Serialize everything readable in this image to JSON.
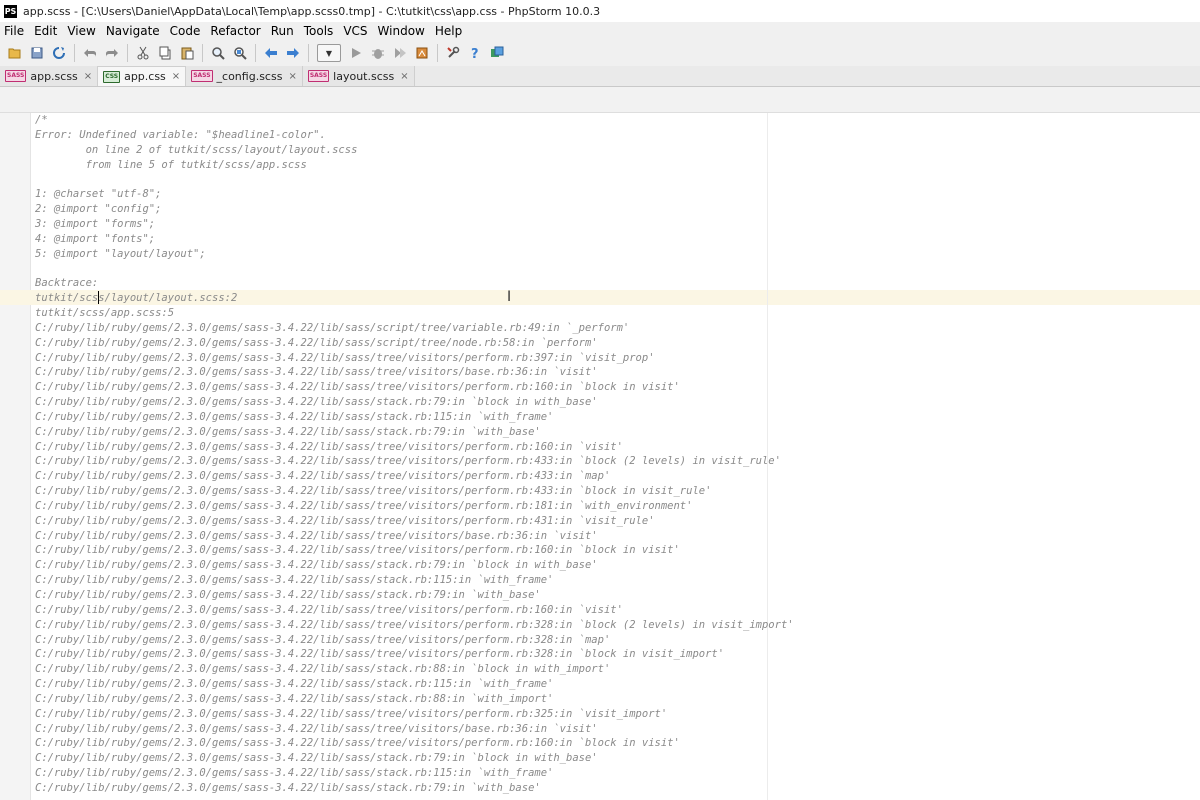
{
  "window": {
    "title": "app.scss - [C:\\Users\\Daniel\\AppData\\Local\\Temp\\app.scss0.tmp] - C:\\tutkit\\css\\app.css - PhpStorm 10.0.3",
    "icon_label": "PS"
  },
  "menu": [
    "File",
    "Edit",
    "View",
    "Navigate",
    "Code",
    "Refactor",
    "Run",
    "Tools",
    "VCS",
    "Window",
    "Help"
  ],
  "toolbar": {
    "icons": [
      "open-folder-icon",
      "save-icon",
      "sync-icon",
      "undo-icon",
      "redo-icon",
      "cut-icon",
      "copy-icon",
      "paste-icon",
      "find-icon",
      "replace-icon",
      "back-icon",
      "forward-icon",
      "run-config-combo",
      "run-icon",
      "debug-icon",
      "coverage-icon",
      "profile-icon",
      "settings-icon",
      "help-icon",
      "phpstorm-update-icon"
    ]
  },
  "tabs": [
    {
      "label": "app.scss",
      "type": "SASS",
      "close": "×"
    },
    {
      "label": "app.css",
      "type": "CSS",
      "close": "×"
    },
    {
      "label": "_config.scss",
      "type": "SASS",
      "close": "×"
    },
    {
      "label": "layout.scss",
      "type": "SASS",
      "close": "×"
    }
  ],
  "editor": {
    "lines": [
      "/*",
      "Error: Undefined variable: \"$headline1-color\".",
      "        on line 2 of tutkit/scss/layout/layout.scss",
      "        from line 5 of tutkit/scss/app.scss",
      "",
      "1: @charset \"utf-8\";",
      "2: @import \"config\";",
      "3: @import \"forms\";",
      "4: @import \"fonts\";",
      "5: @import \"layout/layout\";",
      "",
      "Backtrace:",
      "tutkit/scss/layout/layout.scss:2",
      "tutkit/scss/app.scss:5",
      "C:/ruby/lib/ruby/gems/2.3.0/gems/sass-3.4.22/lib/sass/script/tree/variable.rb:49:in `_perform'",
      "C:/ruby/lib/ruby/gems/2.3.0/gems/sass-3.4.22/lib/sass/script/tree/node.rb:58:in `perform'",
      "C:/ruby/lib/ruby/gems/2.3.0/gems/sass-3.4.22/lib/sass/tree/visitors/perform.rb:397:in `visit_prop'",
      "C:/ruby/lib/ruby/gems/2.3.0/gems/sass-3.4.22/lib/sass/tree/visitors/base.rb:36:in `visit'",
      "C:/ruby/lib/ruby/gems/2.3.0/gems/sass-3.4.22/lib/sass/tree/visitors/perform.rb:160:in `block in visit'",
      "C:/ruby/lib/ruby/gems/2.3.0/gems/sass-3.4.22/lib/sass/stack.rb:79:in `block in with_base'",
      "C:/ruby/lib/ruby/gems/2.3.0/gems/sass-3.4.22/lib/sass/stack.rb:115:in `with_frame'",
      "C:/ruby/lib/ruby/gems/2.3.0/gems/sass-3.4.22/lib/sass/stack.rb:79:in `with_base'",
      "C:/ruby/lib/ruby/gems/2.3.0/gems/sass-3.4.22/lib/sass/tree/visitors/perform.rb:160:in `visit'",
      "C:/ruby/lib/ruby/gems/2.3.0/gems/sass-3.4.22/lib/sass/tree/visitors/perform.rb:433:in `block (2 levels) in visit_rule'",
      "C:/ruby/lib/ruby/gems/2.3.0/gems/sass-3.4.22/lib/sass/tree/visitors/perform.rb:433:in `map'",
      "C:/ruby/lib/ruby/gems/2.3.0/gems/sass-3.4.22/lib/sass/tree/visitors/perform.rb:433:in `block in visit_rule'",
      "C:/ruby/lib/ruby/gems/2.3.0/gems/sass-3.4.22/lib/sass/tree/visitors/perform.rb:181:in `with_environment'",
      "C:/ruby/lib/ruby/gems/2.3.0/gems/sass-3.4.22/lib/sass/tree/visitors/perform.rb:431:in `visit_rule'",
      "C:/ruby/lib/ruby/gems/2.3.0/gems/sass-3.4.22/lib/sass/tree/visitors/base.rb:36:in `visit'",
      "C:/ruby/lib/ruby/gems/2.3.0/gems/sass-3.4.22/lib/sass/tree/visitors/perform.rb:160:in `block in visit'",
      "C:/ruby/lib/ruby/gems/2.3.0/gems/sass-3.4.22/lib/sass/stack.rb:79:in `block in with_base'",
      "C:/ruby/lib/ruby/gems/2.3.0/gems/sass-3.4.22/lib/sass/stack.rb:115:in `with_frame'",
      "C:/ruby/lib/ruby/gems/2.3.0/gems/sass-3.4.22/lib/sass/stack.rb:79:in `with_base'",
      "C:/ruby/lib/ruby/gems/2.3.0/gems/sass-3.4.22/lib/sass/tree/visitors/perform.rb:160:in `visit'",
      "C:/ruby/lib/ruby/gems/2.3.0/gems/sass-3.4.22/lib/sass/tree/visitors/perform.rb:328:in `block (2 levels) in visit_import'",
      "C:/ruby/lib/ruby/gems/2.3.0/gems/sass-3.4.22/lib/sass/tree/visitors/perform.rb:328:in `map'",
      "C:/ruby/lib/ruby/gems/2.3.0/gems/sass-3.4.22/lib/sass/tree/visitors/perform.rb:328:in `block in visit_import'",
      "C:/ruby/lib/ruby/gems/2.3.0/gems/sass-3.4.22/lib/sass/stack.rb:88:in `block in with_import'",
      "C:/ruby/lib/ruby/gems/2.3.0/gems/sass-3.4.22/lib/sass/stack.rb:115:in `with_frame'",
      "C:/ruby/lib/ruby/gems/2.3.0/gems/sass-3.4.22/lib/sass/stack.rb:88:in `with_import'",
      "C:/ruby/lib/ruby/gems/2.3.0/gems/sass-3.4.22/lib/sass/tree/visitors/perform.rb:325:in `visit_import'",
      "C:/ruby/lib/ruby/gems/2.3.0/gems/sass-3.4.22/lib/sass/tree/visitors/base.rb:36:in `visit'",
      "C:/ruby/lib/ruby/gems/2.3.0/gems/sass-3.4.22/lib/sass/tree/visitors/perform.rb:160:in `block in visit'",
      "C:/ruby/lib/ruby/gems/2.3.0/gems/sass-3.4.22/lib/sass/stack.rb:79:in `block in with_base'",
      "C:/ruby/lib/ruby/gems/2.3.0/gems/sass-3.4.22/lib/sass/stack.rb:115:in `with_frame'",
      "C:/ruby/lib/ruby/gems/2.3.0/gems/sass-3.4.22/lib/sass/stack.rb:79:in `with_base'"
    ]
  },
  "colors": {
    "code_text": "#8a8a8a",
    "current_line": "#fbf6e4",
    "sass_badge": "#c02e72",
    "css_badge": "#2d6a2d"
  }
}
